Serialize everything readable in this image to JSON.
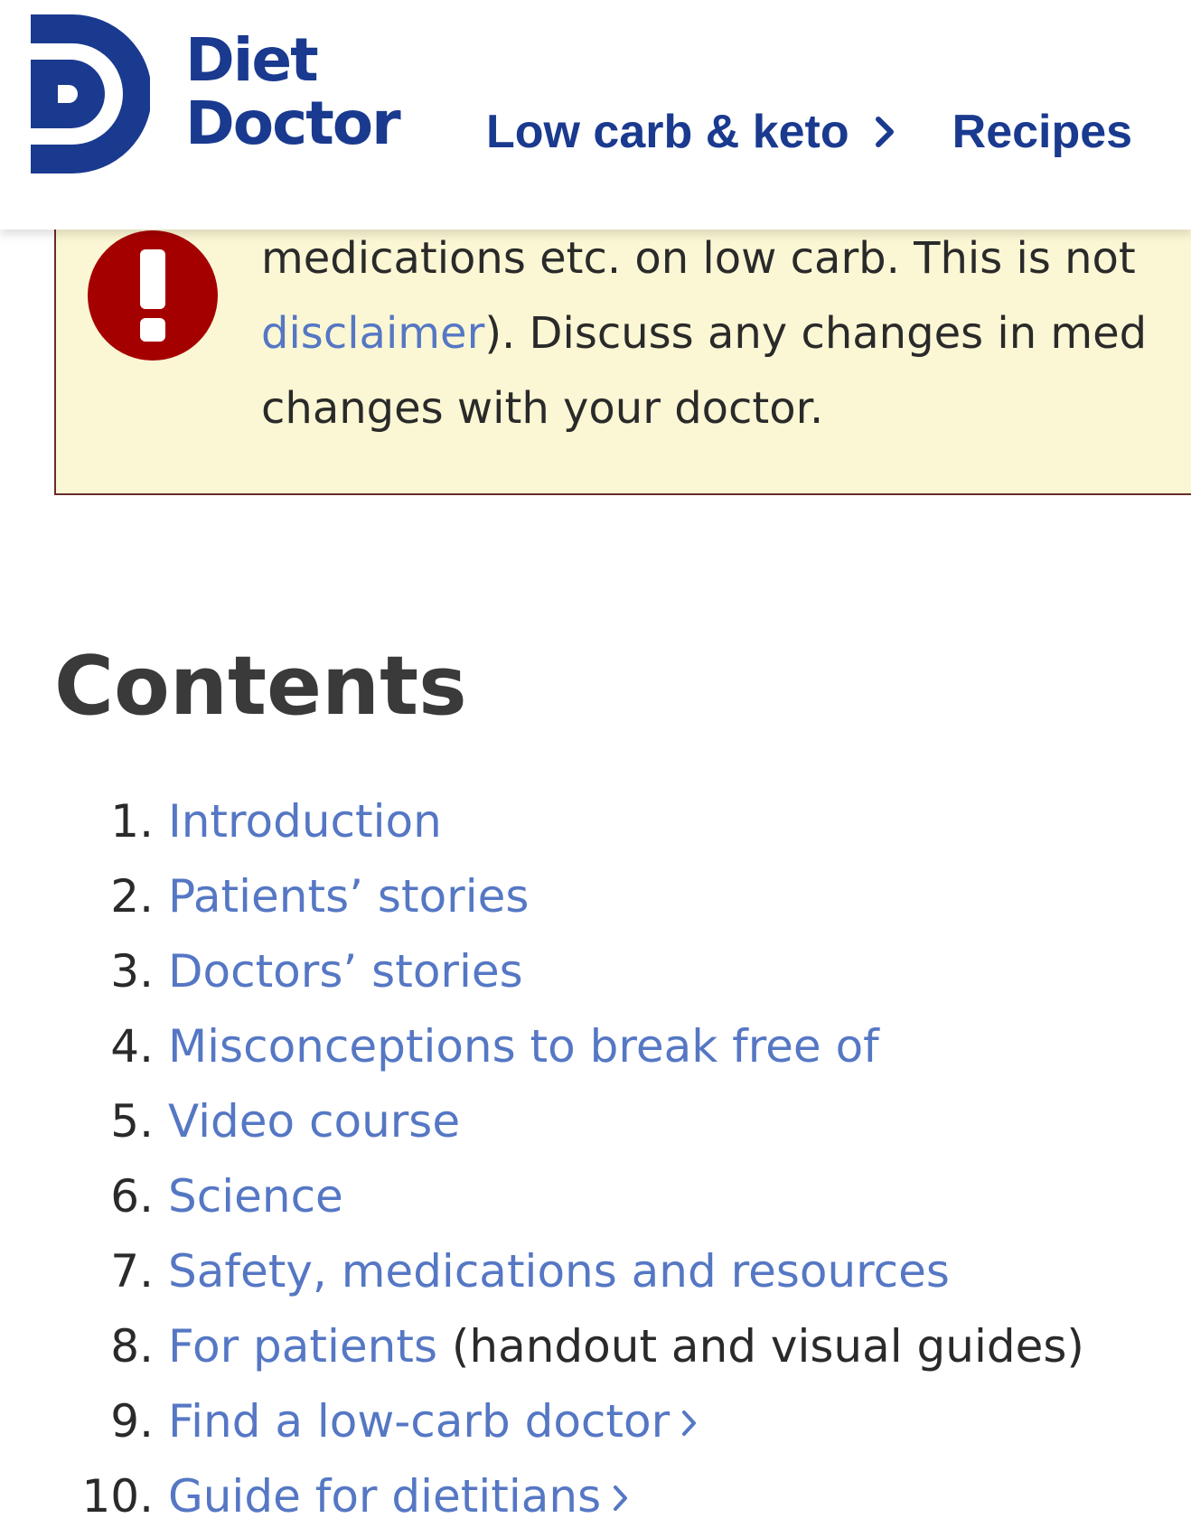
{
  "header": {
    "logo_line1": "Diet",
    "logo_line2": "Doctor",
    "nav": [
      {
        "label": "Low carb & keto"
      },
      {
        "label": "Recipes"
      }
    ]
  },
  "callout": {
    "line1": "medications etc. on low carb. This is not",
    "link": "disclaimer",
    "line2_rest": "). Discuss any changes in med",
    "line3": "changes with your doctor."
  },
  "contents": {
    "title": "Contents",
    "items": [
      {
        "num": "1.",
        "label": "Introduction",
        "suffix": ""
      },
      {
        "num": "2.",
        "label": "Patients’ stories",
        "suffix": ""
      },
      {
        "num": "3.",
        "label": "Doctors’ stories",
        "suffix": ""
      },
      {
        "num": "4.",
        "label": "Misconceptions to break free of",
        "suffix": ""
      },
      {
        "num": "5.",
        "label": "Video course",
        "suffix": ""
      },
      {
        "num": "6.",
        "label": "Science",
        "suffix": ""
      },
      {
        "num": "7.",
        "label": "Safety, medications and resources",
        "suffix": ""
      },
      {
        "num": "8.",
        "label": "For patients",
        "suffix": " (handout and visual guides)"
      },
      {
        "num": "9.",
        "label": "Find a low-carb doctor",
        "suffix": ""
      },
      {
        "num": "10.",
        "label": "Guide for dietitians",
        "suffix": ""
      }
    ]
  },
  "colors": {
    "brand": "#1a3a8f",
    "link": "#5577c4",
    "callout_bg": "#fbf7d4",
    "alert_red": "#a50000"
  },
  "icons": [
    "diet-doctor-logo-icon",
    "chevron-right-icon",
    "exclamation-alert-icon"
  ]
}
